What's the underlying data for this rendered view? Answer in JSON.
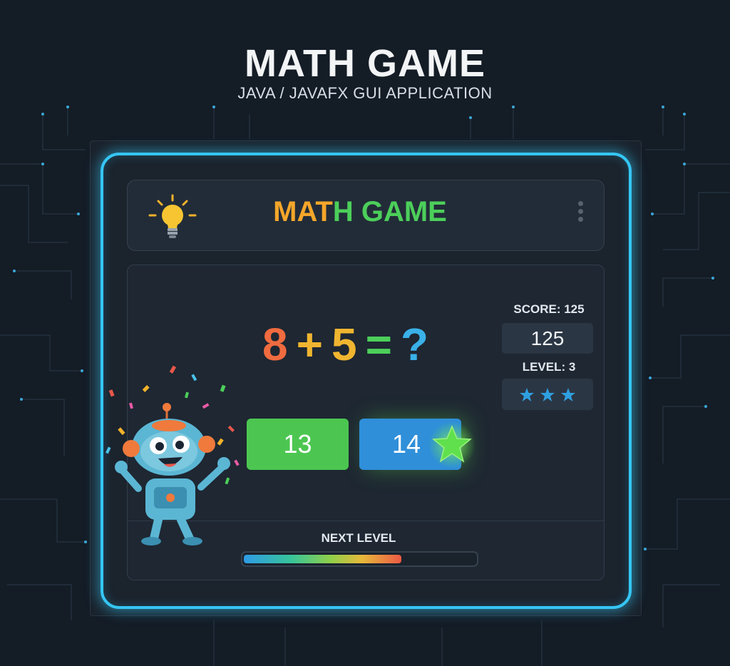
{
  "page": {
    "heading": "MATH GAME",
    "subtitle": "JAVA / JAVAFX GUI APPLICATION"
  },
  "header": {
    "title_part1": "MAT",
    "title_part2": "H GAME",
    "icons": [
      "lightbulb-icon",
      "vertical-dots-menu-icon"
    ]
  },
  "question": {
    "operand_a": "8",
    "operator": "+",
    "operand_b": "5",
    "equals": "=",
    "unknown": "?"
  },
  "answers": [
    {
      "label": "13",
      "color": "#4cc651"
    },
    {
      "label": "14",
      "color": "#2f8fd9"
    }
  ],
  "stats": {
    "score_label": "SCORE: 125",
    "score_value": "125",
    "level_label": "LEVEL: 3",
    "stars": 3
  },
  "progress": {
    "label": "NEXT LEVEL",
    "fraction": 0.68
  },
  "colors": {
    "frame_glow": "#35c6f4",
    "background": "#141c26",
    "title_orange": "#f4a62a",
    "title_green": "#4ccf5a"
  }
}
